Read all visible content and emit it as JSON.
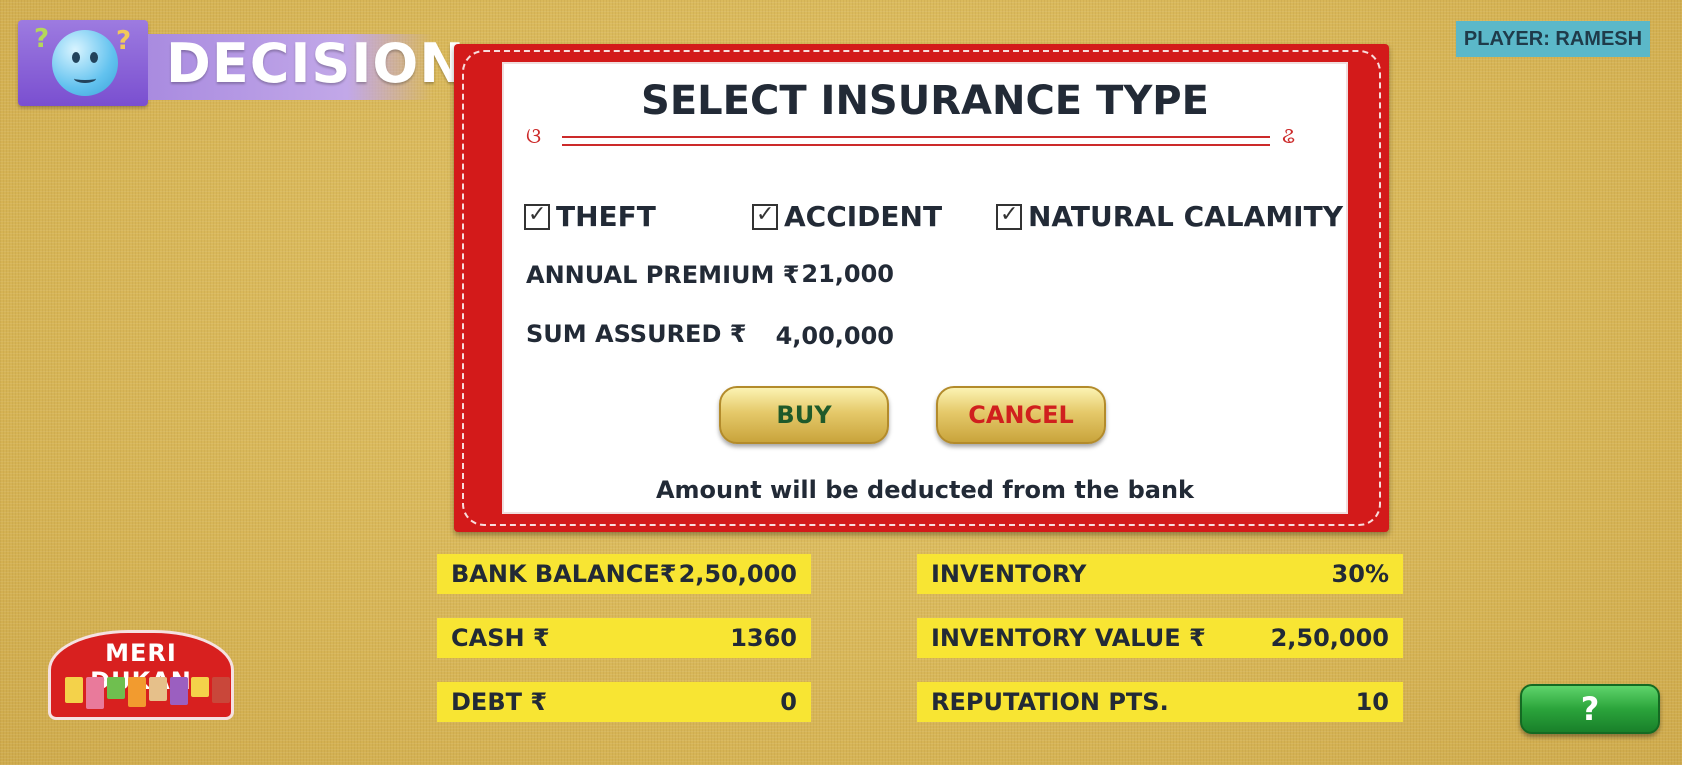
{
  "header": {
    "title": "DECISION",
    "player": "PLAYER: RAMESH",
    "question_marks": [
      "?",
      "?"
    ]
  },
  "dialog": {
    "title": "SELECT INSURANCE TYPE",
    "ornaments": [
      "ଓ",
      "ଌ"
    ],
    "options": [
      {
        "label": "THEFT",
        "checked": true
      },
      {
        "label": "ACCIDENT",
        "checked": true
      },
      {
        "label": "NATURAL CALAMITY",
        "checked": true
      }
    ],
    "annual_premium_label": "ANNUAL PREMIUM ₹",
    "annual_premium_value": "21,000",
    "sum_assured_label": "SUM ASSURED ₹",
    "sum_assured_value": "4,00,000",
    "buy_label": "BUY",
    "cancel_label": "CANCEL",
    "note": "Amount will be deducted from the bank"
  },
  "stats": {
    "bank_balance": {
      "label": "BANK BALANCE₹",
      "value": "2,50,000"
    },
    "cash": {
      "label": "CASH ₹",
      "value": "1360"
    },
    "debt": {
      "label": "DEBT ₹",
      "value": "0"
    },
    "inventory": {
      "label": "INVENTORY",
      "value": "30%"
    },
    "inventory_value": {
      "label": "INVENTORY VALUE ₹",
      "value": "2,50,000"
    },
    "reputation": {
      "label": "REPUTATION PTS.",
      "value": "10"
    }
  },
  "logo": {
    "text": "MERI DUKAN"
  },
  "help": {
    "label": "?"
  },
  "colors": {
    "background": "#d8b859",
    "dialog_frame": "#d31a1a",
    "stat_panel": "#f8e533",
    "player_badge": "#5bb8c9",
    "buy_text": "#1f5a2a",
    "cancel_text": "#d0201e",
    "help_button": "#2ba43b"
  },
  "icons": {
    "decision": "thinking-face-icon",
    "checkbox": "checked-box-icon",
    "help": "question-mark-icon"
  }
}
